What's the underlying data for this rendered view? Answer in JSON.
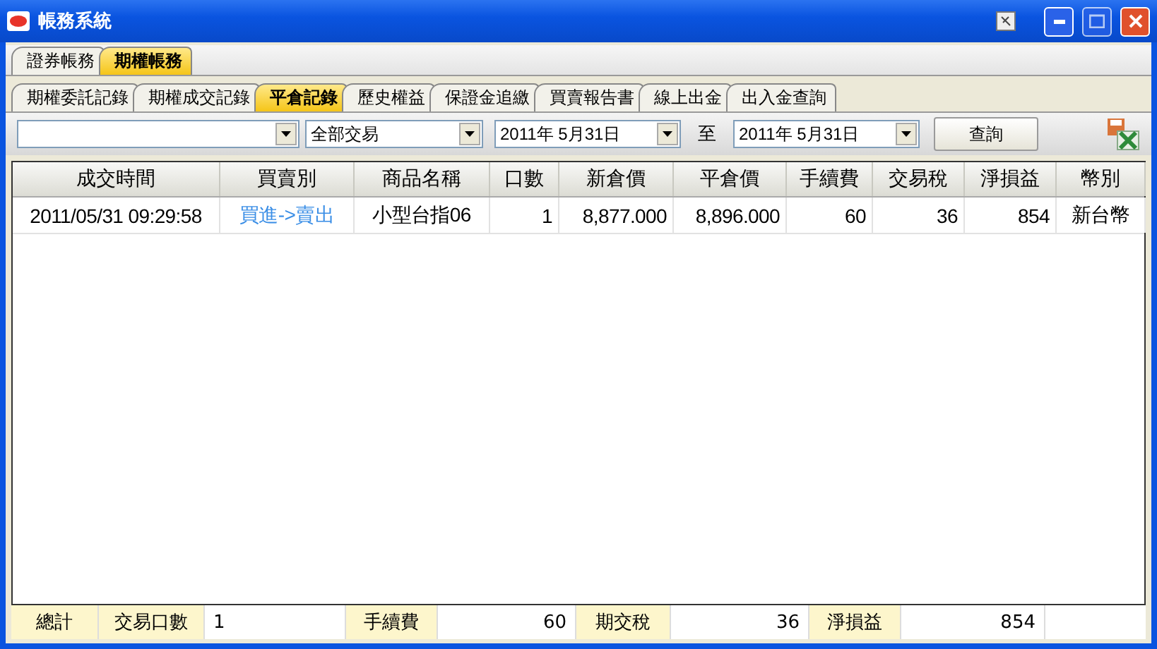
{
  "window": {
    "title": "帳務系統"
  },
  "main_tabs": [
    {
      "label": "證券帳務",
      "selected": false
    },
    {
      "label": "期權帳務",
      "selected": true
    }
  ],
  "sub_tabs": [
    {
      "label": "期權委託記錄",
      "selected": false
    },
    {
      "label": "期權成交記錄",
      "selected": false
    },
    {
      "label": "平倉記錄",
      "selected": true
    },
    {
      "label": "歷史權益",
      "selected": false
    },
    {
      "label": "保證金追繳",
      "selected": false
    },
    {
      "label": "買賣報告書",
      "selected": false
    },
    {
      "label": "線上出金",
      "selected": false
    },
    {
      "label": "出入金查詢",
      "selected": false
    }
  ],
  "filters": {
    "trade_type": "全部交易",
    "date_from": "2011年  5月31日",
    "to_label": "至",
    "date_to": "2011年  5月31日",
    "query_button": "查詢"
  },
  "table": {
    "columns": [
      "成交時間",
      "買賣別",
      "商品名稱",
      "口數",
      "新倉價",
      "平倉價",
      "手續費",
      "交易稅",
      "淨損益",
      "幣別"
    ],
    "rows": [
      [
        "2011/05/31 09:29:58",
        "買進->賣出",
        "小型台指06",
        "1",
        "8,877.000",
        "8,896.000",
        "60",
        "36",
        "854",
        "新台幣"
      ]
    ]
  },
  "summary": [
    {
      "label": "總計"
    },
    {
      "label": "交易口數",
      "value": "1"
    },
    {
      "label": "手續費",
      "value": "60"
    },
    {
      "label": "期交稅",
      "value": "36"
    },
    {
      "label": "淨損益",
      "value": "854"
    }
  ]
}
